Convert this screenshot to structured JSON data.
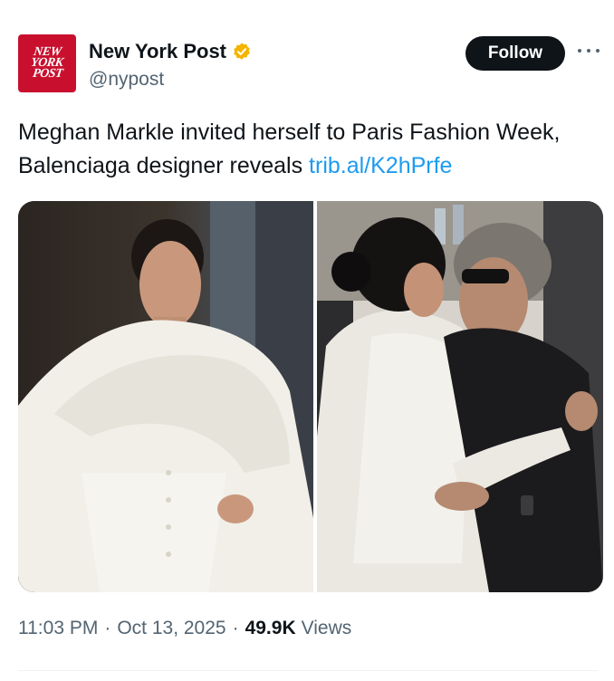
{
  "account": {
    "display_name": "New York Post",
    "handle": "@nypost",
    "avatar_lines": [
      "NEW",
      "YORK",
      "POST"
    ],
    "verified_color": "#f4b400"
  },
  "actions": {
    "follow_label": "Follow",
    "more_icon": "more-horizontal-icon"
  },
  "tweet": {
    "text": "Meghan Markle invited herself to Paris Fashion Week, Balenciaga designer reveals ",
    "link": "trib.al/K2hPrfe"
  },
  "meta": {
    "time": "11:03 PM",
    "separator": "·",
    "date": "Oct 13, 2025",
    "views_count": "49.9K",
    "views_label": "Views"
  },
  "colors": {
    "link": "#1d9bf0",
    "follow_bg": "#0f1419",
    "secondary_text": "#536471",
    "brand_red": "#c8102e"
  }
}
